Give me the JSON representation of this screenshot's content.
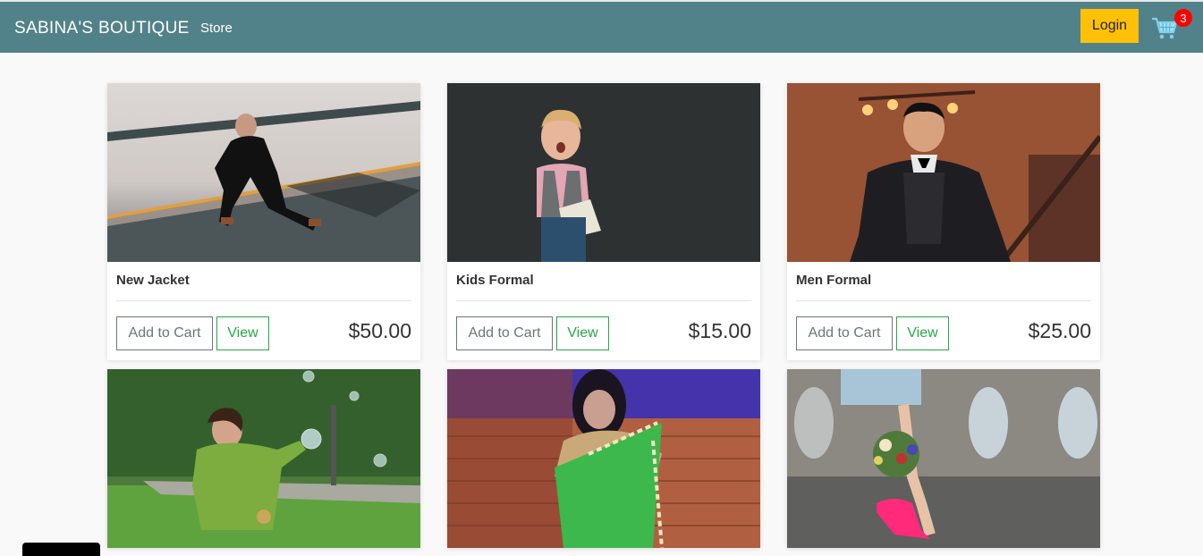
{
  "navbar": {
    "brand": "SABINA'S BOUTIQUE",
    "links": [
      "Store"
    ],
    "login_label": "Login",
    "cart_count": "3",
    "cart_icon": "shopping-cart-icon"
  },
  "colors": {
    "navbar": "#528289",
    "login": "#ffc107",
    "badge": "#ff0000",
    "view": "#28a745",
    "add_to_cart": "#6c757d"
  },
  "products": [
    {
      "name": "New Jacket",
      "price": "$50.00",
      "add_label": "Add to Cart",
      "view_label": "View",
      "image": "woman-in-black-suit-photo"
    },
    {
      "name": "Kids Formal",
      "price": "$15.00",
      "add_label": "Add to Cart",
      "view_label": "View",
      "image": "boy-holding-book-photo"
    },
    {
      "name": "Men Formal",
      "price": "$25.00",
      "add_label": "Add to Cart",
      "view_label": "View",
      "image": "man-in-three-piece-suit-photo"
    },
    {
      "name": "",
      "price": "",
      "add_label": "",
      "view_label": "",
      "image": "girl-with-bubbles-photo"
    },
    {
      "name": "",
      "price": "",
      "add_label": "",
      "view_label": "",
      "image": "woman-in-green-saree-photo"
    },
    {
      "name": "",
      "price": "",
      "add_label": "",
      "view_label": "",
      "image": "pink-heels-bouquet-photo"
    }
  ]
}
